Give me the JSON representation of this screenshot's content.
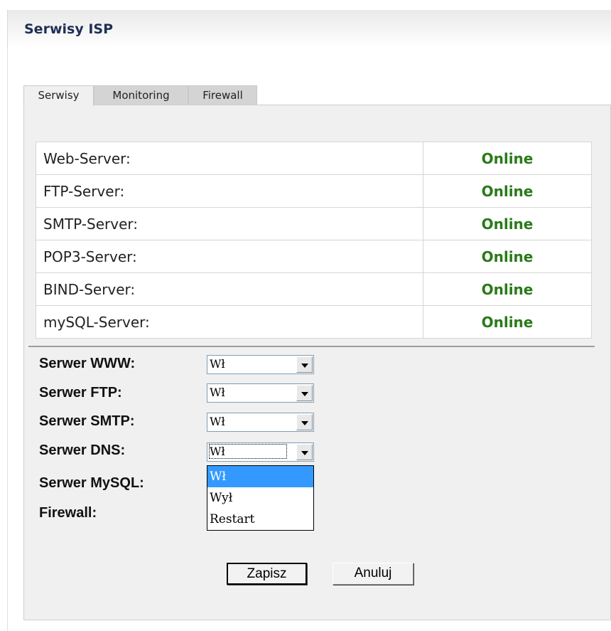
{
  "panel": {
    "title": "Serwisy ISP"
  },
  "tabs": [
    {
      "label": "Serwisy",
      "active": true
    },
    {
      "label": "Monitoring",
      "active": false
    },
    {
      "label": "Firewall",
      "active": false
    }
  ],
  "services": {
    "rows": [
      {
        "name": "Web-Server:",
        "status": "Online"
      },
      {
        "name": "FTP-Server:",
        "status": "Online"
      },
      {
        "name": "SMTP-Server:",
        "status": "Online"
      },
      {
        "name": "POP3-Server:",
        "status": "Online"
      },
      {
        "name": "BIND-Server:",
        "status": "Online"
      },
      {
        "name": "mySQL-Server:",
        "status": "Online"
      }
    ],
    "status_color": "#2a7a1a"
  },
  "controls": [
    {
      "label": "Serwer WWW:",
      "value": "Wł"
    },
    {
      "label": "Serwer FTP:",
      "value": "Wł"
    },
    {
      "label": "Serwer SMTP:",
      "value": "Wł"
    },
    {
      "label": "Serwer DNS:",
      "value": "Wł"
    },
    {
      "label": "Serwer MySQL:"
    },
    {
      "label": "Firewall:"
    }
  ],
  "dropdown": {
    "options": [
      "Wł",
      "Wył",
      "Restart"
    ],
    "selected_index": 0,
    "highlight_color": "#3399ff"
  },
  "buttons": {
    "save": "Zapisz",
    "cancel": "Anuluj"
  }
}
